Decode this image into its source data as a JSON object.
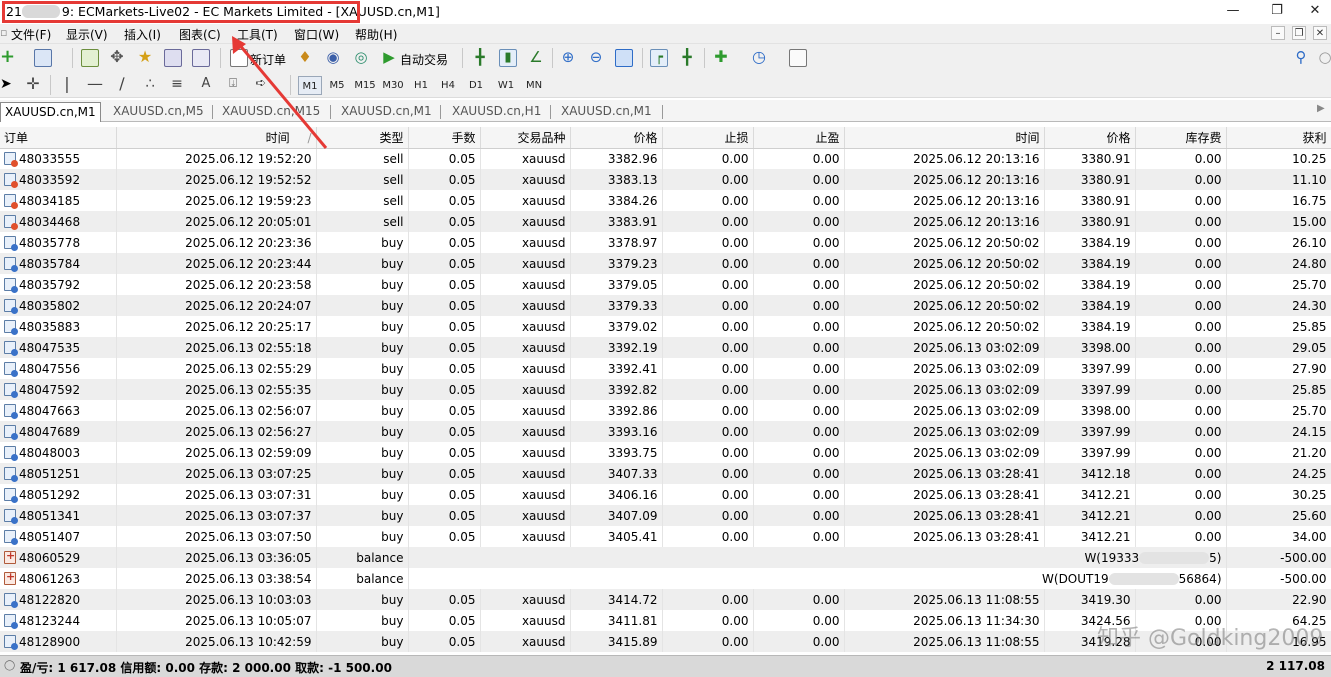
{
  "title": {
    "prefix": "21",
    "text": "9: ECMarkets-Live02 - EC Markets Limited - [XAUUSD.cn,M1]"
  },
  "menu": [
    "文件(F)",
    "显示(V)",
    "插入(I)",
    "图表(C)",
    "工具(T)",
    "窗口(W)",
    "帮助(H)"
  ],
  "toolbar": {
    "new_order": "新订单",
    "auto_trade": "自动交易"
  },
  "timeframes": [
    "M1",
    "M5",
    "M15",
    "M30",
    "H1",
    "H4",
    "D1",
    "W1",
    "MN"
  ],
  "tabs": [
    "XAUUSD.cn,M1",
    "XAUUSD.cn,M5",
    "XAUUSD.cn,M15",
    "XAUUSD.cn,M1",
    "XAUUSD.cn,H1",
    "XAUUSD.cn,M1"
  ],
  "columns": [
    "订单",
    "时间",
    "类型",
    "手数",
    "交易品种",
    "价格",
    "止损",
    "止盈",
    "时间",
    "价格",
    "库存费",
    "获利"
  ],
  "sort_mark": "/",
  "rows": [
    {
      "order": "48033555",
      "open": "2025.06.12 19:52:20",
      "type": "sell",
      "lots": "0.05",
      "symbol": "xauusd",
      "price": "3382.96",
      "sl": "0.00",
      "tp": "0.00",
      "close": "2025.06.12 20:13:16",
      "cprice": "3380.91",
      "swap": "0.00",
      "profit": "10.25"
    },
    {
      "order": "48033592",
      "open": "2025.06.12 19:52:52",
      "type": "sell",
      "lots": "0.05",
      "symbol": "xauusd",
      "price": "3383.13",
      "sl": "0.00",
      "tp": "0.00",
      "close": "2025.06.12 20:13:16",
      "cprice": "3380.91",
      "swap": "0.00",
      "profit": "11.10"
    },
    {
      "order": "48034185",
      "open": "2025.06.12 19:59:23",
      "type": "sell",
      "lots": "0.05",
      "symbol": "xauusd",
      "price": "3384.26",
      "sl": "0.00",
      "tp": "0.00",
      "close": "2025.06.12 20:13:16",
      "cprice": "3380.91",
      "swap": "0.00",
      "profit": "16.75"
    },
    {
      "order": "48034468",
      "open": "2025.06.12 20:05:01",
      "type": "sell",
      "lots": "0.05",
      "symbol": "xauusd",
      "price": "3383.91",
      "sl": "0.00",
      "tp": "0.00",
      "close": "2025.06.12 20:13:16",
      "cprice": "3380.91",
      "swap": "0.00",
      "profit": "15.00"
    },
    {
      "order": "48035778",
      "open": "2025.06.12 20:23:36",
      "type": "buy",
      "lots": "0.05",
      "symbol": "xauusd",
      "price": "3378.97",
      "sl": "0.00",
      "tp": "0.00",
      "close": "2025.06.12 20:50:02",
      "cprice": "3384.19",
      "swap": "0.00",
      "profit": "26.10"
    },
    {
      "order": "48035784",
      "open": "2025.06.12 20:23:44",
      "type": "buy",
      "lots": "0.05",
      "symbol": "xauusd",
      "price": "3379.23",
      "sl": "0.00",
      "tp": "0.00",
      "close": "2025.06.12 20:50:02",
      "cprice": "3384.19",
      "swap": "0.00",
      "profit": "24.80"
    },
    {
      "order": "48035792",
      "open": "2025.06.12 20:23:58",
      "type": "buy",
      "lots": "0.05",
      "symbol": "xauusd",
      "price": "3379.05",
      "sl": "0.00",
      "tp": "0.00",
      "close": "2025.06.12 20:50:02",
      "cprice": "3384.19",
      "swap": "0.00",
      "profit": "25.70"
    },
    {
      "order": "48035802",
      "open": "2025.06.12 20:24:07",
      "type": "buy",
      "lots": "0.05",
      "symbol": "xauusd",
      "price": "3379.33",
      "sl": "0.00",
      "tp": "0.00",
      "close": "2025.06.12 20:50:02",
      "cprice": "3384.19",
      "swap": "0.00",
      "profit": "24.30"
    },
    {
      "order": "48035883",
      "open": "2025.06.12 20:25:17",
      "type": "buy",
      "lots": "0.05",
      "symbol": "xauusd",
      "price": "3379.02",
      "sl": "0.00",
      "tp": "0.00",
      "close": "2025.06.12 20:50:02",
      "cprice": "3384.19",
      "swap": "0.00",
      "profit": "25.85"
    },
    {
      "order": "48047535",
      "open": "2025.06.13 02:55:18",
      "type": "buy",
      "lots": "0.05",
      "symbol": "xauusd",
      "price": "3392.19",
      "sl": "0.00",
      "tp": "0.00",
      "close": "2025.06.13 03:02:09",
      "cprice": "3398.00",
      "swap": "0.00",
      "profit": "29.05"
    },
    {
      "order": "48047556",
      "open": "2025.06.13 02:55:29",
      "type": "buy",
      "lots": "0.05",
      "symbol": "xauusd",
      "price": "3392.41",
      "sl": "0.00",
      "tp": "0.00",
      "close": "2025.06.13 03:02:09",
      "cprice": "3397.99",
      "swap": "0.00",
      "profit": "27.90"
    },
    {
      "order": "48047592",
      "open": "2025.06.13 02:55:35",
      "type": "buy",
      "lots": "0.05",
      "symbol": "xauusd",
      "price": "3392.82",
      "sl": "0.00",
      "tp": "0.00",
      "close": "2025.06.13 03:02:09",
      "cprice": "3397.99",
      "swap": "0.00",
      "profit": "25.85"
    },
    {
      "order": "48047663",
      "open": "2025.06.13 02:56:07",
      "type": "buy",
      "lots": "0.05",
      "symbol": "xauusd",
      "price": "3392.86",
      "sl": "0.00",
      "tp": "0.00",
      "close": "2025.06.13 03:02:09",
      "cprice": "3398.00",
      "swap": "0.00",
      "profit": "25.70"
    },
    {
      "order": "48047689",
      "open": "2025.06.13 02:56:27",
      "type": "buy",
      "lots": "0.05",
      "symbol": "xauusd",
      "price": "3393.16",
      "sl": "0.00",
      "tp": "0.00",
      "close": "2025.06.13 03:02:09",
      "cprice": "3397.99",
      "swap": "0.00",
      "profit": "24.15"
    },
    {
      "order": "48048003",
      "open": "2025.06.13 02:59:09",
      "type": "buy",
      "lots": "0.05",
      "symbol": "xauusd",
      "price": "3393.75",
      "sl": "0.00",
      "tp": "0.00",
      "close": "2025.06.13 03:02:09",
      "cprice": "3397.99",
      "swap": "0.00",
      "profit": "21.20"
    },
    {
      "order": "48051251",
      "open": "2025.06.13 03:07:25",
      "type": "buy",
      "lots": "0.05",
      "symbol": "xauusd",
      "price": "3407.33",
      "sl": "0.00",
      "tp": "0.00",
      "close": "2025.06.13 03:28:41",
      "cprice": "3412.18",
      "swap": "0.00",
      "profit": "24.25"
    },
    {
      "order": "48051292",
      "open": "2025.06.13 03:07:31",
      "type": "buy",
      "lots": "0.05",
      "symbol": "xauusd",
      "price": "3406.16",
      "sl": "0.00",
      "tp": "0.00",
      "close": "2025.06.13 03:28:41",
      "cprice": "3412.21",
      "swap": "0.00",
      "profit": "30.25"
    },
    {
      "order": "48051341",
      "open": "2025.06.13 03:07:37",
      "type": "buy",
      "lots": "0.05",
      "symbol": "xauusd",
      "price": "3407.09",
      "sl": "0.00",
      "tp": "0.00",
      "close": "2025.06.13 03:28:41",
      "cprice": "3412.21",
      "swap": "0.00",
      "profit": "25.60"
    },
    {
      "order": "48051407",
      "open": "2025.06.13 03:07:50",
      "type": "buy",
      "lots": "0.05",
      "symbol": "xauusd",
      "price": "3405.41",
      "sl": "0.00",
      "tp": "0.00",
      "close": "2025.06.13 03:28:41",
      "cprice": "3412.21",
      "swap": "0.00",
      "profit": "34.00"
    },
    {
      "order": "48060529",
      "open": "2025.06.13 03:36:05",
      "type": "balance",
      "comment_start": "W(19333",
      "comment_end": "5)",
      "profit": "-500.00"
    },
    {
      "order": "48061263",
      "open": "2025.06.13 03:38:54",
      "type": "balance",
      "comment_start": "W(DOUT19",
      "comment_end": "56864)",
      "profit": "-500.00"
    },
    {
      "order": "48122820",
      "open": "2025.06.13 10:03:03",
      "type": "buy",
      "lots": "0.05",
      "symbol": "xauusd",
      "price": "3414.72",
      "sl": "0.00",
      "tp": "0.00",
      "close": "2025.06.13 11:08:55",
      "cprice": "3419.30",
      "swap": "0.00",
      "profit": "22.90"
    },
    {
      "order": "48123244",
      "open": "2025.06.13 10:05:07",
      "type": "buy",
      "lots": "0.05",
      "symbol": "xauusd",
      "price": "3411.81",
      "sl": "0.00",
      "tp": "0.00",
      "close": "2025.06.13 11:34:30",
      "cprice": "3424.56",
      "swap": "0.00",
      "profit": "64.25"
    },
    {
      "order": "48128900",
      "open": "2025.06.13 10:42:59",
      "type": "buy",
      "lots": "0.05",
      "symbol": "xauusd",
      "price": "3415.89",
      "sl": "0.00",
      "tp": "0.00",
      "close": "2025.06.13 11:08:55",
      "cprice": "3419.28",
      "swap": "0.00",
      "profit": "16.95"
    }
  ],
  "status": {
    "summary": "盈/亏: 1 617.08  信用额: 0.00  存款: 2 000.00  取款: -1 500.00",
    "total": "2 117.08"
  },
  "watermark": "知乎 @Goldking2009",
  "colors": {
    "highlight": "#e53935",
    "sell_icon": "#e0502c",
    "buy_icon": "#3a72c8"
  }
}
